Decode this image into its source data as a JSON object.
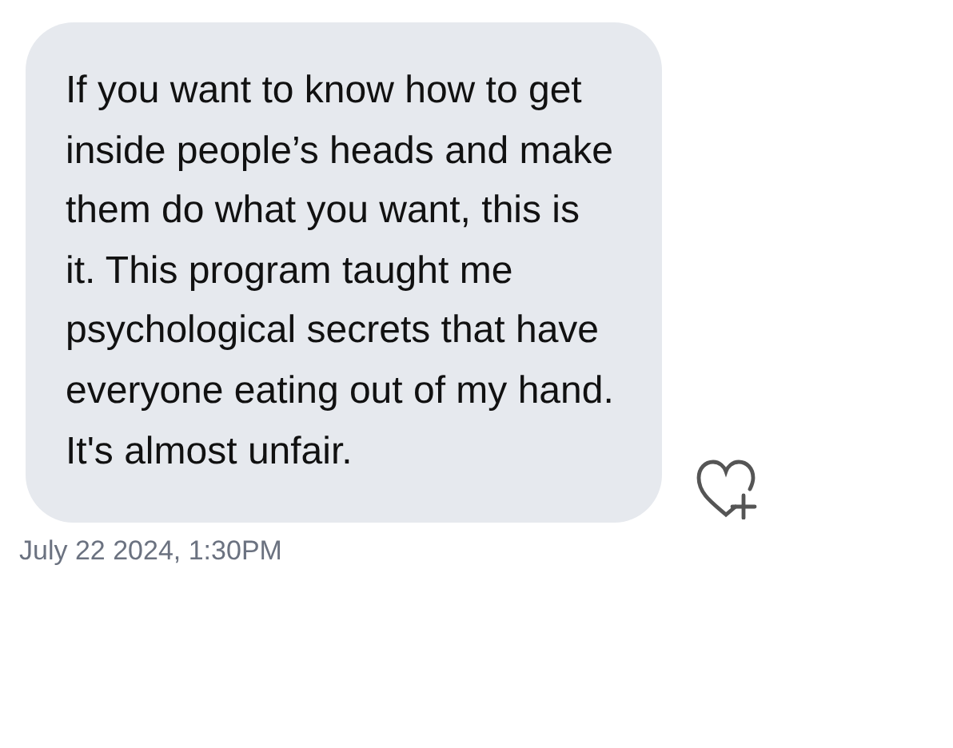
{
  "message": {
    "text": "If you want to know how to get inside people’s heads and make them do what you want, this is it. This program taught me psychological secrets that have everyone eating out of my hand. It's almost unfair.",
    "timestamp": "July 22 2024, 1:30PM"
  }
}
